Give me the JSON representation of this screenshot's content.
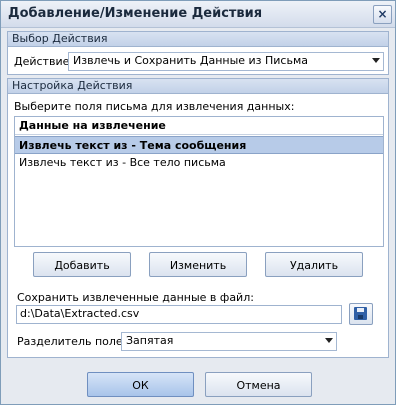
{
  "window": {
    "title": "Добавление/Изменение Действия",
    "close": "×"
  },
  "action_group": {
    "header": "Выбор Действия",
    "label": "Действие",
    "selected": "Извлечь и Сохранить Данные из Письма"
  },
  "settings_group": {
    "header": "Настройка Действия",
    "instruction": "Выберите поля письма для извлечения данных:",
    "list": {
      "header": "Данные на извлечение",
      "rows": [
        "Извлечь текст из - Тема сообщения",
        "Извлечь текст из - Все тело письма"
      ]
    },
    "buttons": {
      "add": "Добавить",
      "edit": "Изменить",
      "delete": "Удалить"
    },
    "save_label": "Сохранить извлеченные данные в файл:",
    "file_path": "d:\\Data\\Extracted.csv",
    "separator_label": "Разделитель полей:",
    "separator": "Запятая"
  },
  "footer": {
    "ok": "ОК",
    "cancel": "Отмена"
  }
}
